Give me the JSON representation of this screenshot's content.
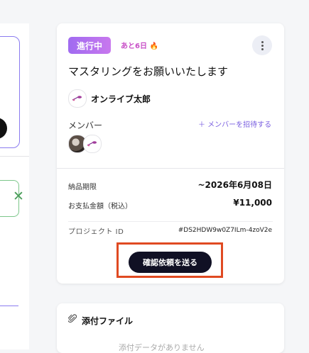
{
  "project": {
    "status_badge": "進行中",
    "days_left": "あと6日 🔥",
    "title": "マスタリングをお願いいたします",
    "owner_name": "オンライブ太郎",
    "members_label": "メンバー",
    "invite_label": "＋ メンバーを招待する",
    "delivery_label": "納品期限",
    "delivery_value": "~2026年6月08日",
    "amount_label": "お支払金額（税込）",
    "amount_value": "¥11,000",
    "project_id_label": "プロジェクト ID",
    "project_id_value": "#DS2HDW9w0Z7ILm-4zoV2e",
    "send_button": "確認依頼を送る"
  },
  "attachments": {
    "title": "添付ファイル",
    "empty_text": "添付データがありません"
  },
  "icons": {
    "more": "more-vertical-icon",
    "attach": "paperclip-icon",
    "close": "close-icon",
    "guitar": "guitar-logo-icon"
  },
  "colors": {
    "badge_start": "#a06bf0",
    "badge_end": "#c878ee",
    "accent": "#7a5fe0",
    "button": "#101024",
    "highlight": "#e04a22"
  }
}
